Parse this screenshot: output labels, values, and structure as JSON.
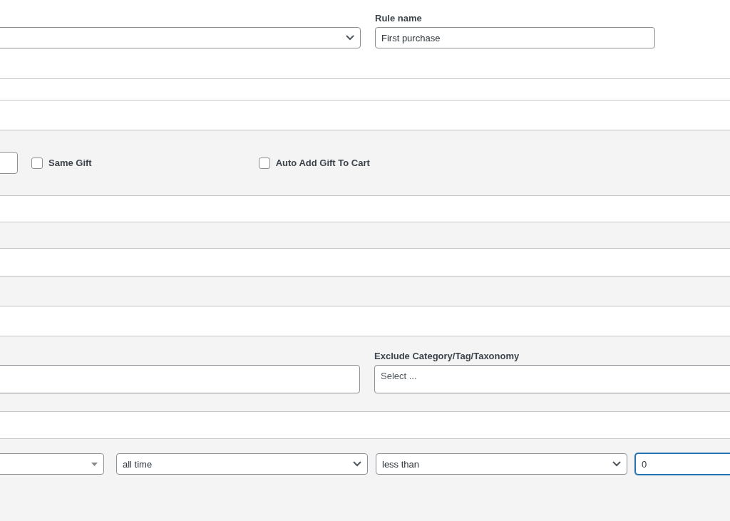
{
  "rule_name": {
    "label": "Rule name",
    "value": "First purchase"
  },
  "gift_options": [
    {
      "label": "Same Gift",
      "checked": false
    },
    {
      "label": "Auto Add Gift To Cart",
      "checked": false
    }
  ],
  "exclude": {
    "label": "Exclude Category/Tag/Taxonomy",
    "placeholder": "Select ..."
  },
  "condition": {
    "selects": [
      {
        "value": "all time"
      },
      {
        "value": "less than"
      }
    ],
    "amount": "0"
  }
}
